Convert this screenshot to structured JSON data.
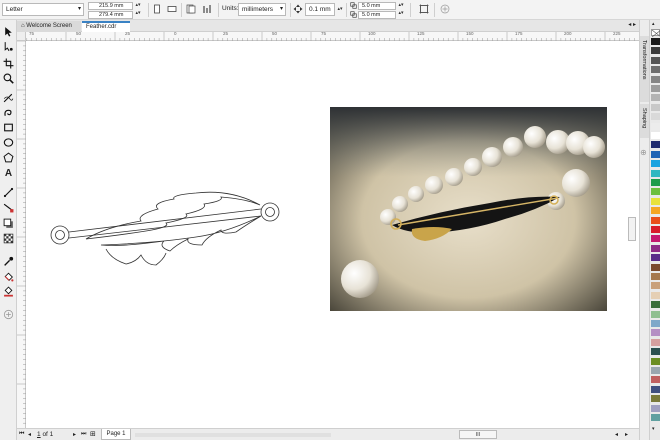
{
  "property_bar": {
    "paper_size": "Letter",
    "width": "215.9 mm",
    "height": "279.4 mm",
    "units_label": "Units:",
    "units_value": "millimeters",
    "nudge": "0.1 mm",
    "dup_x": "5.0 mm",
    "dup_y": "5.0 mm"
  },
  "tabs": [
    {
      "label": "Welcome Screen",
      "icon": "home-icon"
    },
    {
      "label": "Feather.cdr",
      "active": true
    }
  ],
  "rulers": {
    "horizontal_marks": [
      "75",
      "50",
      "25",
      "0",
      "25",
      "50",
      "75",
      "100",
      "125",
      "150",
      "175",
      "200",
      "225"
    ],
    "vertical_marks": [
      "250",
      "225",
      "200",
      "175",
      "150",
      "125",
      "100",
      "75",
      "50",
      "25"
    ]
  },
  "status": {
    "page_current": "1",
    "page_of": "of",
    "page_total": "1",
    "page_tab": "Page 1"
  },
  "dockers": {
    "transformations": "Transformations",
    "shaping": "Shaping"
  },
  "palette": [
    "#1a1a1a",
    "#3b3b3b",
    "#555555",
    "#6e6e6e",
    "#858585",
    "#9c9c9c",
    "#b3b3b3",
    "#c8c8c8",
    "#d9d9d9",
    "#ececec",
    "#ffffff",
    "#1f2a6e",
    "#1e63b5",
    "#1ba3e0",
    "#2fb7c1",
    "#1c9b4b",
    "#6cbf3f",
    "#e8e23a",
    "#f5a623",
    "#e94e1b",
    "#d81b2b",
    "#c4186f",
    "#8e2a86",
    "#5a2d8a",
    "#7a4a2e",
    "#a6784d",
    "#c9a07a",
    "#e5cfb4",
    "#3a6e3a",
    "#8fbf8f",
    "#7fa8c9",
    "#b58fc4",
    "#d6a0a0",
    "#2b4f4f",
    "#6b8e23",
    "#9aa7b0",
    "#c06060",
    "#405080",
    "#7a7a3a",
    "#a0a0c0",
    "#60a0a0"
  ]
}
